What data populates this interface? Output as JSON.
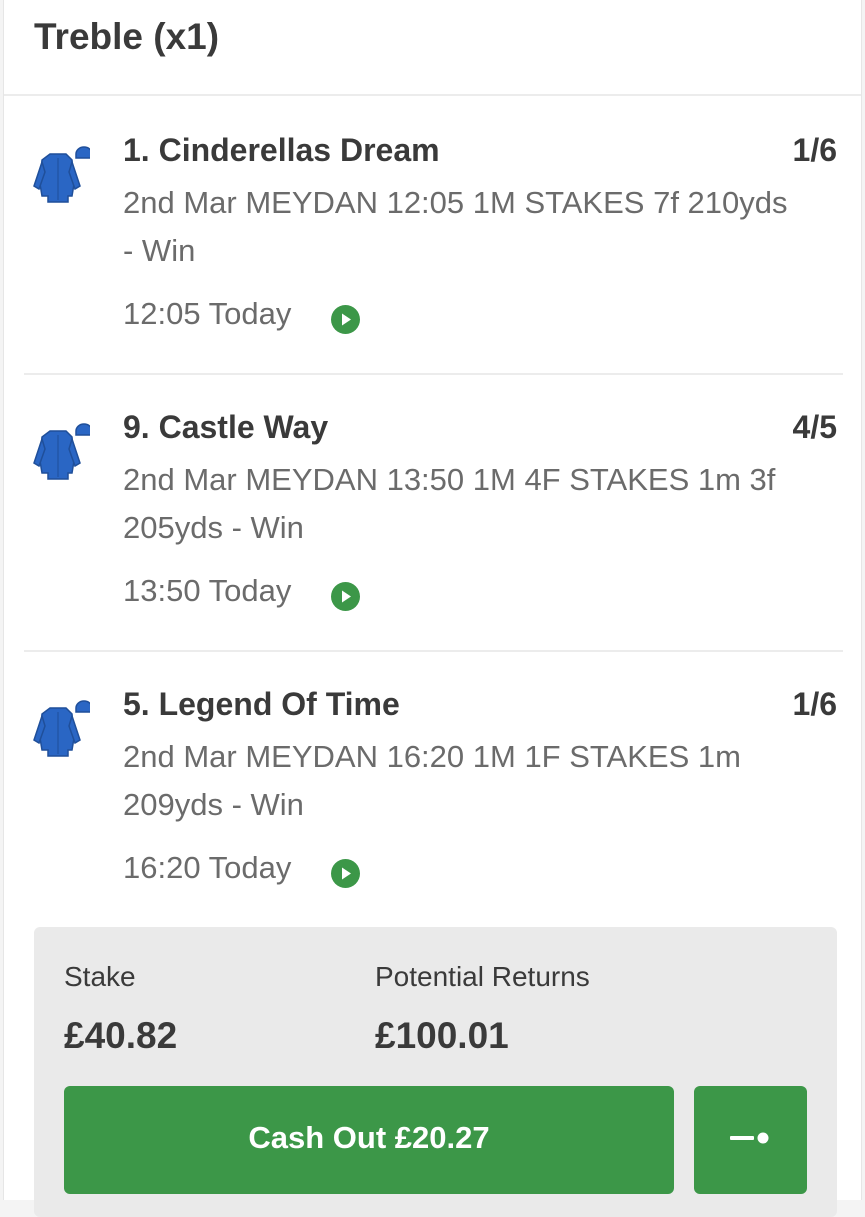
{
  "header": {
    "title": "Treble (x1)"
  },
  "selections": [
    {
      "name": "1. Cinderellas Dream",
      "odds": "1/6",
      "description": "2nd Mar MEYDAN 12:05 1M STAKES 7f 210yds - Win",
      "time": "12:05 Today"
    },
    {
      "name": "9. Castle Way",
      "odds": "4/5",
      "description": "2nd Mar MEYDAN 13:50 1M 4F STAKES 1m 3f 205yds - Win",
      "time": "13:50 Today"
    },
    {
      "name": "5. Legend Of Time",
      "odds": "1/6",
      "description": "2nd Mar MEYDAN 16:20 1M 1F STAKES 1m 209yds - Win",
      "time": "16:20 Today"
    }
  ],
  "summary": {
    "stake_label": "Stake",
    "stake_value": "£40.82",
    "returns_label": "Potential Returns",
    "returns_value": "£100.01"
  },
  "actions": {
    "cashout_label": "Cash Out £20.27",
    "toggle_icon": "partial-cashout-slider-icon"
  },
  "colors": {
    "accent_green": "#3c9748",
    "silk_blue": "#2a66c4",
    "text_dark": "#3a3a3a",
    "text_muted": "#6b6b6b"
  }
}
